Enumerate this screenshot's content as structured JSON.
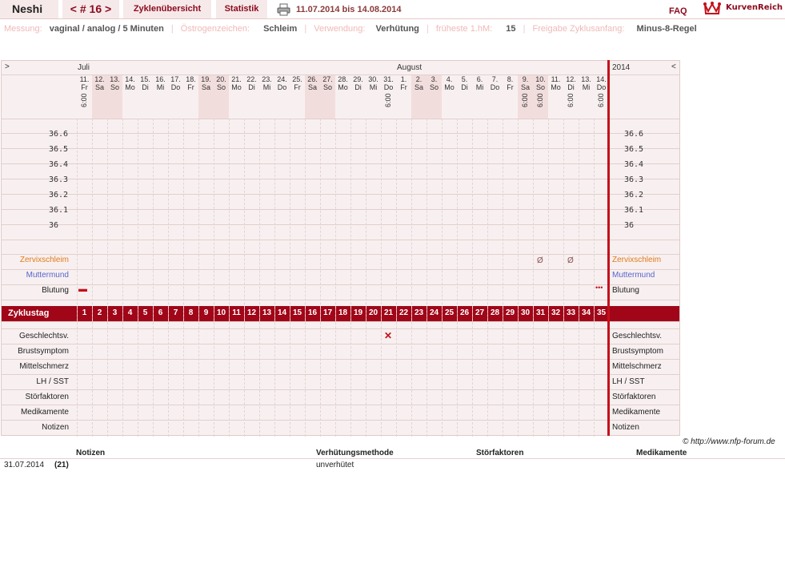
{
  "topbar": {
    "name": "Neshi",
    "cycle_nav": "< # 16 >",
    "cycle_overview": "Zyklenübersicht",
    "statistics": "Statistik",
    "print_icon": "printer-icon",
    "date_range": "11.07.2014 bis 14.08.2014",
    "faq": "FAQ",
    "brand": "KurvenReich",
    "brand_icon": "crown-icon"
  },
  "info": {
    "measure_label": "Messung:",
    "measure_value": "vaginal / analog / 5 Minuten",
    "estrogen_label": "Östrogenzeichen:",
    "estrogen_value": "Schleim",
    "usage_label": "Verwendung:",
    "usage_value": "Verhütung",
    "earliest_label": "früheste 1.hM:",
    "earliest_value": "15",
    "release_label": "Freigabe Zyklusanfang:",
    "release_value": "Minus-8-Regel"
  },
  "chart": {
    "left_arrow": ">",
    "right_arrow": "<",
    "month_july": "Juli",
    "month_august": "August",
    "year": "2014",
    "days": [
      {
        "d": "11.",
        "w": "Fr",
        "t": "6:00",
        "we": false
      },
      {
        "d": "12.",
        "w": "Sa",
        "t": "",
        "we": true
      },
      {
        "d": "13.",
        "w": "So",
        "t": "",
        "we": true
      },
      {
        "d": "14.",
        "w": "Mo",
        "t": "",
        "we": false
      },
      {
        "d": "15.",
        "w": "Di",
        "t": "",
        "we": false
      },
      {
        "d": "16.",
        "w": "Mi",
        "t": "",
        "we": false
      },
      {
        "d": "17.",
        "w": "Do",
        "t": "",
        "we": false
      },
      {
        "d": "18.",
        "w": "Fr",
        "t": "",
        "we": false
      },
      {
        "d": "19.",
        "w": "Sa",
        "t": "",
        "we": true
      },
      {
        "d": "20.",
        "w": "So",
        "t": "",
        "we": true
      },
      {
        "d": "21.",
        "w": "Mo",
        "t": "",
        "we": false
      },
      {
        "d": "22.",
        "w": "Di",
        "t": "",
        "we": false
      },
      {
        "d": "23.",
        "w": "Mi",
        "t": "",
        "we": false
      },
      {
        "d": "24.",
        "w": "Do",
        "t": "",
        "we": false
      },
      {
        "d": "25.",
        "w": "Fr",
        "t": "",
        "we": false
      },
      {
        "d": "26.",
        "w": "Sa",
        "t": "",
        "we": true
      },
      {
        "d": "27.",
        "w": "So",
        "t": "",
        "we": true
      },
      {
        "d": "28.",
        "w": "Mo",
        "t": "",
        "we": false
      },
      {
        "d": "29.",
        "w": "Di",
        "t": "",
        "we": false
      },
      {
        "d": "30.",
        "w": "Mi",
        "t": "",
        "we": false
      },
      {
        "d": "31.",
        "w": "Do",
        "t": "6:00",
        "we": false
      },
      {
        "d": "1.",
        "w": "Fr",
        "t": "",
        "we": false
      },
      {
        "d": "2.",
        "w": "Sa",
        "t": "",
        "we": true
      },
      {
        "d": "3.",
        "w": "So",
        "t": "",
        "we": true
      },
      {
        "d": "4.",
        "w": "Mo",
        "t": "",
        "we": false
      },
      {
        "d": "5.",
        "w": "Di",
        "t": "",
        "we": false
      },
      {
        "d": "6.",
        "w": "Mi",
        "t": "",
        "we": false
      },
      {
        "d": "7.",
        "w": "Do",
        "t": "",
        "we": false
      },
      {
        "d": "8.",
        "w": "Fr",
        "t": "",
        "we": false
      },
      {
        "d": "9.",
        "w": "Sa",
        "t": "6:00",
        "we": true
      },
      {
        "d": "10.",
        "w": "So",
        "t": "6:00",
        "we": true
      },
      {
        "d": "11.",
        "w": "Mo",
        "t": "",
        "we": false
      },
      {
        "d": "12.",
        "w": "Di",
        "t": "6:00",
        "we": false
      },
      {
        "d": "13.",
        "w": "Mi",
        "t": "",
        "we": false
      },
      {
        "d": "14.",
        "w": "Do",
        "t": "6:00",
        "we": false
      }
    ],
    "temps": [
      "36.6",
      "36.5",
      "36.4",
      "36.3",
      "36.2",
      "36.1",
      "36"
    ],
    "row_zervix": "Zervixschleim",
    "row_muttermund": "Muttermund",
    "row_blutung": "Blutung",
    "zyklustag_label": "Zyklustag",
    "cycle_days": [
      "1",
      "2",
      "3",
      "4",
      "5",
      "6",
      "7",
      "8",
      "9",
      "10",
      "11",
      "12",
      "13",
      "14",
      "15",
      "16",
      "17",
      "18",
      "19",
      "20",
      "21",
      "22",
      "23",
      "24",
      "25",
      "26",
      "27",
      "28",
      "29",
      "30",
      "31",
      "32",
      "33",
      "34",
      "35"
    ],
    "mucus_marks": [
      {
        "col": 30,
        "sym": "Ø"
      },
      {
        "col": 32,
        "sym": "Ø"
      }
    ],
    "bleeding_first": "▬",
    "bleeding_last": "•••",
    "intercourse_mark": {
      "col": 20,
      "sym": "✕"
    },
    "lower_rows": [
      "Geschlechtsv.",
      "Brustsymptom",
      "Mittelschmerz",
      "LH / SST",
      "Störfaktoren",
      "Medikamente",
      "Notizen"
    ]
  },
  "footer": {
    "copyright": "© http://www.nfp-forum.de",
    "notes_header": "Notizen",
    "method_header": "Verhütungsmethode",
    "disturb_header": "Störfaktoren",
    "meds_header": "Medikamente",
    "entry_date": "31.07.2014",
    "entry_day": "(21)",
    "entry_method": "unverhütet"
  }
}
